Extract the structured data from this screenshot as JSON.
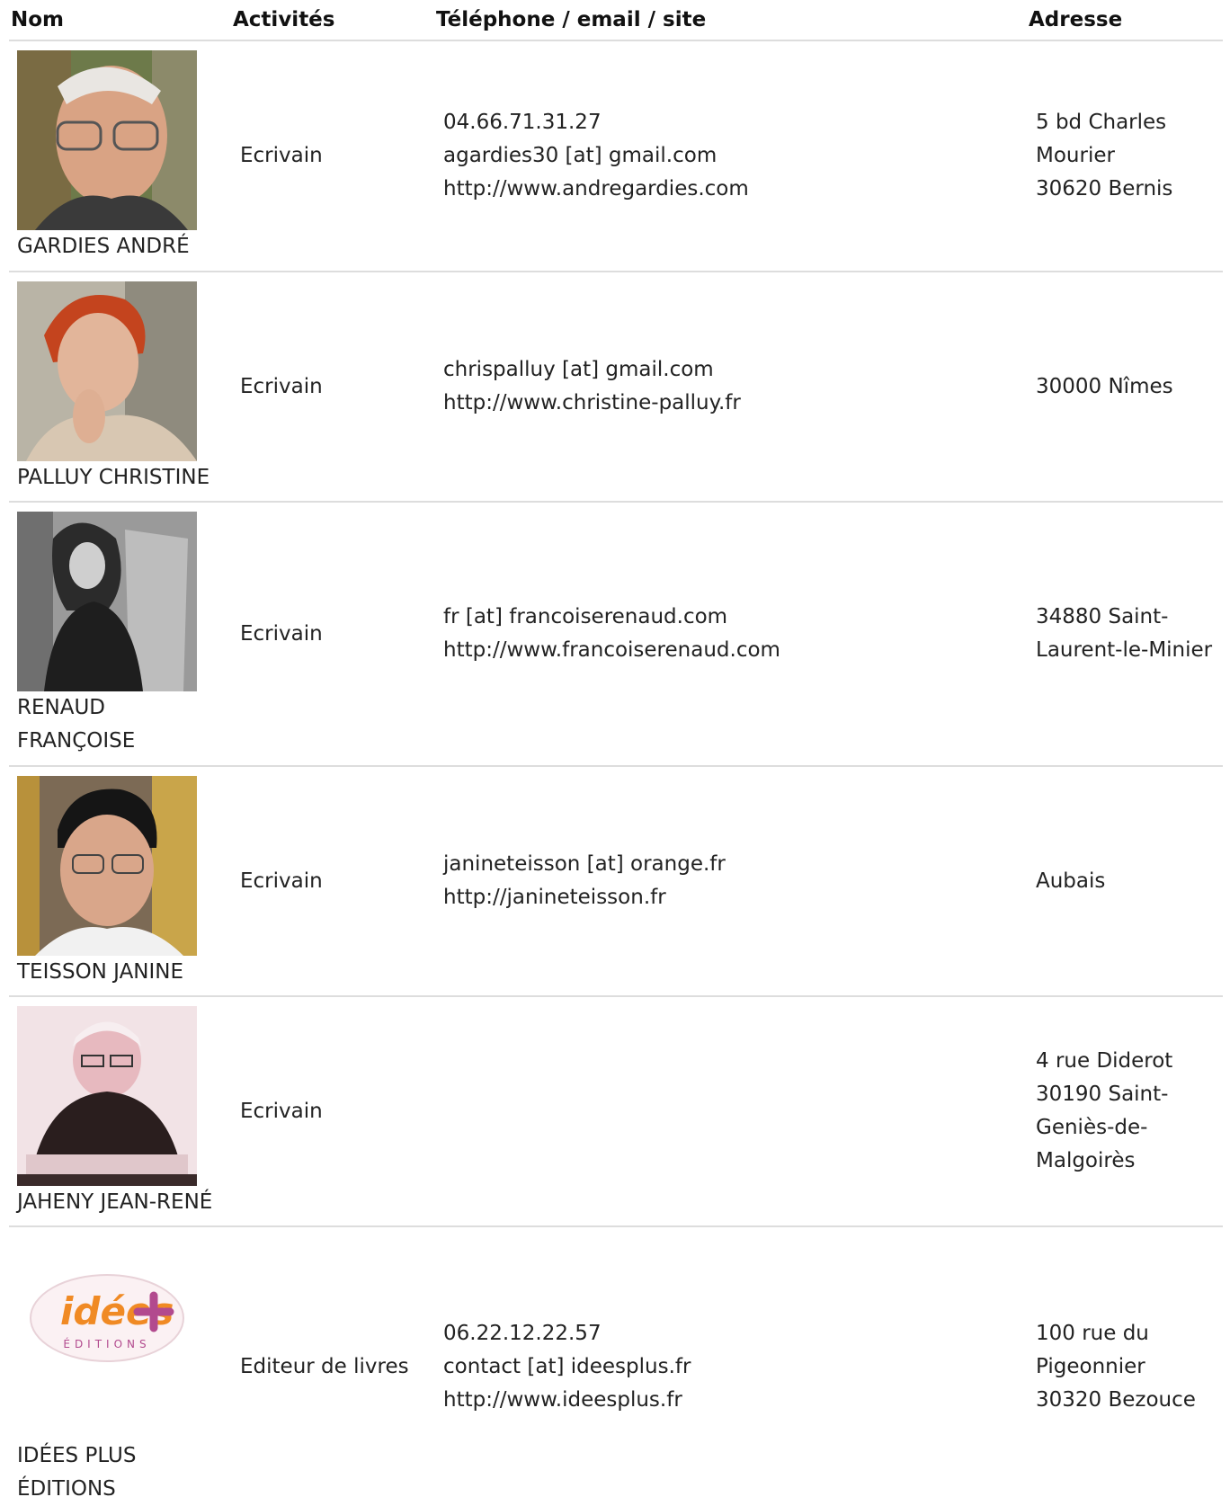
{
  "header": {
    "nom": "Nom",
    "activites": "Activités",
    "contact": "Téléphone / email / site",
    "adresse": "Adresse"
  },
  "rows": [
    {
      "name": "GARDIES ANDRÉ",
      "activity": "Ecrivain",
      "contact": [
        "04.66.71.31.27",
        "agardies30 [at] gmail.com",
        "http://www.andregardies.com"
      ],
      "address": [
        "5 bd Charles",
        "Mourier",
        "30620 Bernis"
      ]
    },
    {
      "name": "PALLUY CHRISTINE",
      "activity": "Ecrivain",
      "contact": [
        "chrispalluy [at] gmail.com",
        "http://www.christine-palluy.fr"
      ],
      "address": [
        "30000 Nîmes"
      ]
    },
    {
      "name": [
        "RENAUD",
        "FRANÇOISE"
      ],
      "activity": "Ecrivain",
      "contact": [
        "fr [at] francoiserenaud.com",
        "http://www.francoiserenaud.com"
      ],
      "address": [
        "34880 Saint-",
        "Laurent-le-Minier"
      ]
    },
    {
      "name": "TEISSON JANINE",
      "activity": "Ecrivain",
      "contact": [
        "janineteisson [at] orange.fr",
        "http://janineteisson.fr"
      ],
      "address": [
        "Aubais"
      ]
    },
    {
      "name": "JAHENY JEAN-RENÉ",
      "activity": "Ecrivain",
      "contact": [],
      "address": [
        "4 rue Diderot",
        "30190 Saint-",
        "Geniès-de-",
        "Malgoirès"
      ]
    },
    {
      "name": [
        "IDÉES PLUS",
        "ÉDITIONS"
      ],
      "activity": "Editeur de livres",
      "contact": [
        "06.22.12.22.57",
        "contact [at] ideesplus.fr",
        "http://www.ideesplus.fr"
      ],
      "address": [
        "100 rue du",
        "Pigeonnier",
        "30320 Bezouce"
      ],
      "logo": {
        "word": "idées",
        "sub": "ÉDITIONS"
      }
    }
  ]
}
